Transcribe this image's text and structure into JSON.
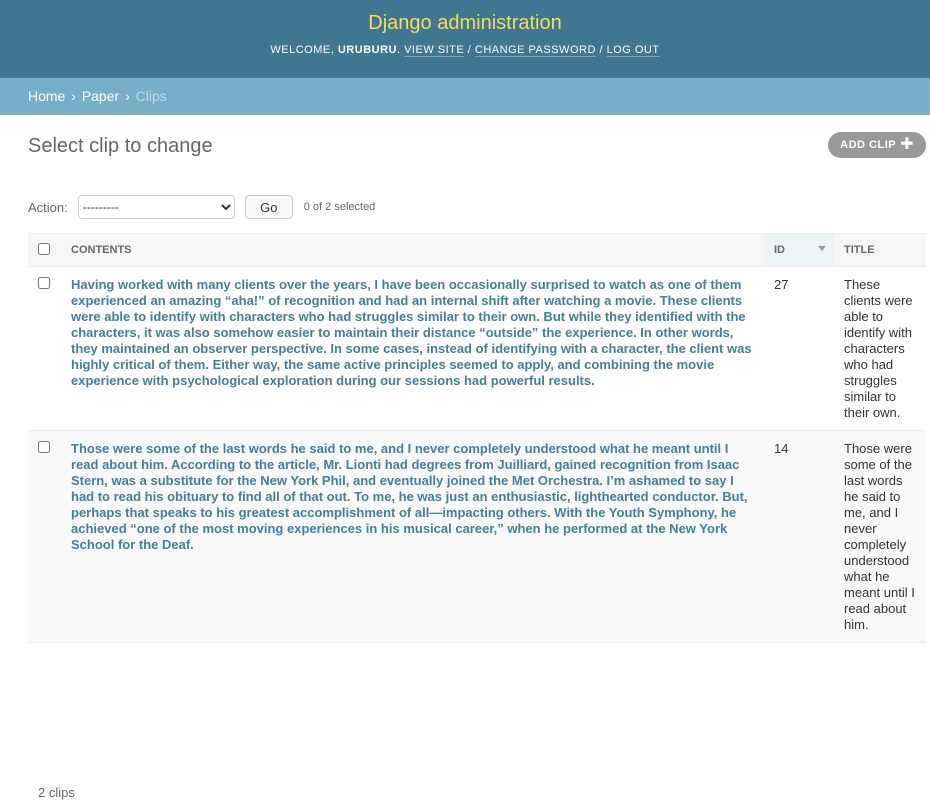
{
  "header": {
    "branding": "Django administration",
    "welcome": "Welcome,",
    "username": "uruburu",
    "view_site": "View site",
    "change_password": "Change password",
    "log_out": "Log out",
    "separator": "/"
  },
  "breadcrumbs": {
    "home": "Home",
    "app": "Paper",
    "current": "Clips",
    "separator": "›"
  },
  "page": {
    "title": "Select clip to change",
    "add_button": "Add clip",
    "add_icon": "plus-icon"
  },
  "actions": {
    "label": "Action:",
    "selected_option": "---------",
    "go": "Go",
    "counter": "0 of 2 selected"
  },
  "table": {
    "headers": {
      "contents": "Contents",
      "id": "ID",
      "title": "Title"
    },
    "sorted_column": "ID",
    "rows": [
      {
        "contents": "Having worked with many clients over the years, I have been occasionally surprised to watch as one of them experienced an amazing “aha!” of recognition and had an internal shift after watching a movie. These clients were able to identify with characters who had struggles similar to their own. But while they identified with the characters, it was also somehow easier to maintain their distance “outside” the experience. In other words, they maintained an observer perspective. In some cases, instead of identifying with a character, the client was highly critical of them. Either way, the same active principles seemed to apply, and combining the movie experience with psychological exploration during our sessions had powerful results.",
        "id": "27",
        "title": "These clients were able to identify with characters who had struggles similar to their own."
      },
      {
        "contents": "Those were some of the last words he said to me, and I never completely understood what he meant until I read about him. According to the article, Mr. Lionti had degrees from Juilliard, gained recognition from Isaac Stern, was a substitute for the New York Phil, and eventually joined the Met Orchestra. I’m ashamed to say I had to read his obituary to find all of that out. To me, he was just an enthusiastic, lighthearted conductor. But, perhaps that speaks to his greatest accomplishment of all—impacting others. With the Youth Symphony, he achieved “one of the most moving experiences in his musical career,” when he performed at the New York School for the Deaf.",
        "id": "14",
        "title": "Those were some of the last words he said to me, and I never completely understood what he meant until I read about him."
      }
    ]
  },
  "paginator": "2 clips"
}
